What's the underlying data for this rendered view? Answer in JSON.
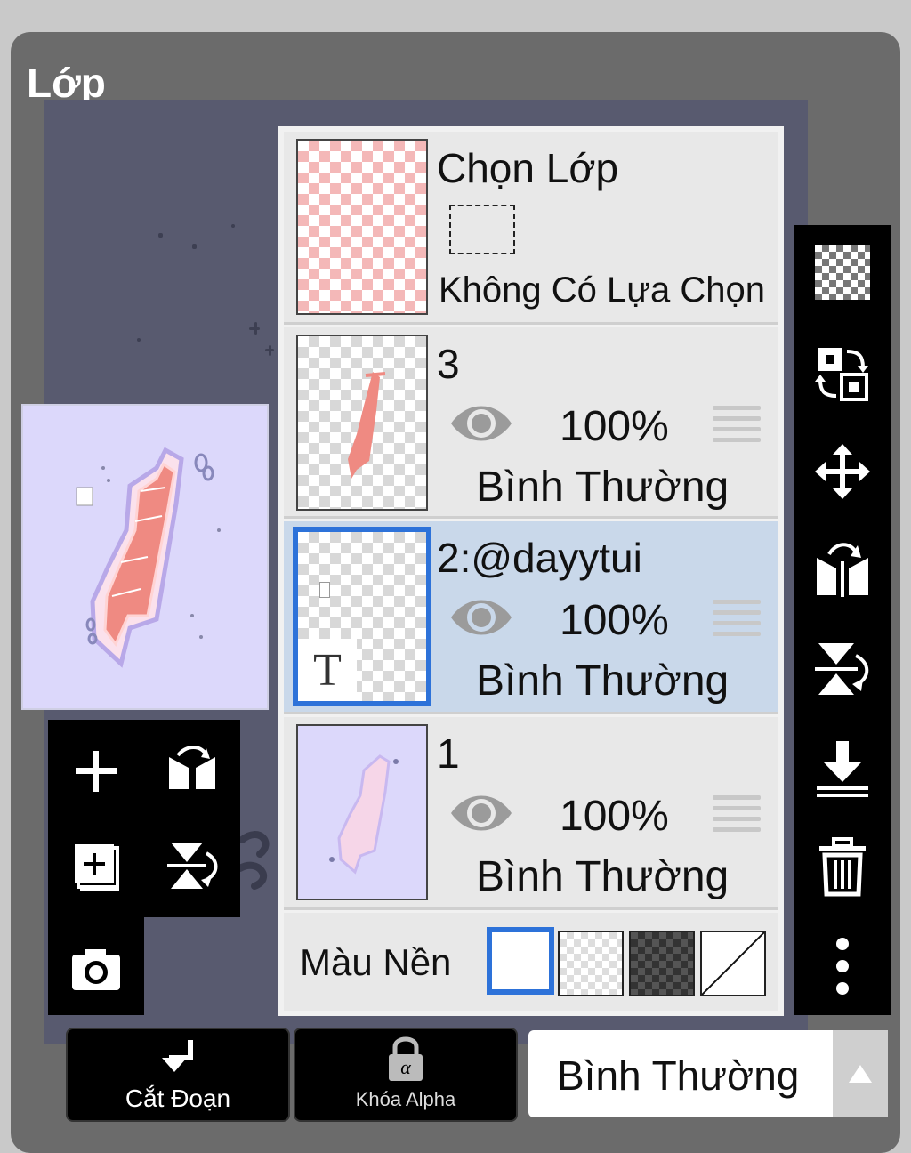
{
  "panel": {
    "title": "Lớp"
  },
  "layers": [
    {
      "id": "select",
      "name": "Chọn Lớp",
      "subtitle": "Không Có Lựa Chọn"
    },
    {
      "id": "3",
      "name": "3",
      "opacity": "100%",
      "blend": "Bình Thường",
      "visible": true,
      "selected": false
    },
    {
      "id": "2",
      "name": "2:@dayytui",
      "opacity": "100%",
      "blend": "Bình Thường",
      "visible": true,
      "selected": true,
      "text_badge": "T"
    },
    {
      "id": "1",
      "name": "1",
      "opacity": "100%",
      "blend": "Bình Thường",
      "visible": true,
      "selected": false
    }
  ],
  "background": {
    "label": "Màu Nền",
    "swatches": [
      "white",
      "transparent",
      "dark-checker",
      "none"
    ],
    "selected": "white"
  },
  "bottom_bar": {
    "cut_label": "Cắt Đoạn",
    "alpha_lock_label": "Khóa Alpha",
    "blend_mode_value": "Bình Thường"
  },
  "right_tools": [
    "transparency-icon",
    "swap-icon",
    "move-icon",
    "flip-horizontal-icon",
    "flip-vertical-icon",
    "merge-down-icon",
    "trash-icon",
    "more-icon"
  ],
  "left_tools": [
    "add-layer-icon",
    "flip-horizontal-icon",
    "add-copy-icon",
    "flip-vertical-icon",
    "camera-icon"
  ],
  "colors": {
    "accent": "#2d72d9",
    "selected_row": "#c9d8ea",
    "panel": "#6b6b6b",
    "preview_bg": "#dcd8fb",
    "lettering": "#ef8a82"
  }
}
